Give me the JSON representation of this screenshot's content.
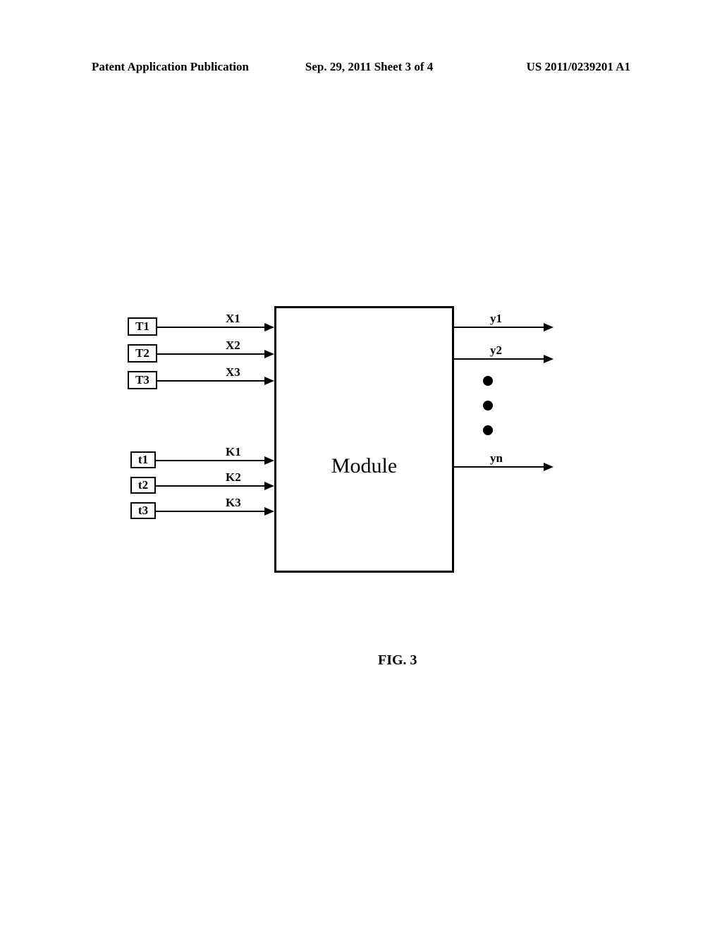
{
  "header": {
    "left": "Patent Application Publication",
    "center": "Sep. 29, 2011  Sheet 3 of 4",
    "right": "US 2011/0239201 A1"
  },
  "inputs_top": [
    {
      "box": "T1",
      "signal": "X1"
    },
    {
      "box": "T2",
      "signal": "X2"
    },
    {
      "box": "T3",
      "signal": "X3"
    }
  ],
  "inputs_bottom": [
    {
      "box": "t1",
      "signal": "K1"
    },
    {
      "box": "t2",
      "signal": "K2"
    },
    {
      "box": "t3",
      "signal": "K3"
    }
  ],
  "module_label": "Module",
  "outputs": [
    {
      "signal": "y1"
    },
    {
      "signal": "y2"
    },
    {
      "signal": "yn"
    }
  ],
  "figure_caption": "FIG. 3"
}
